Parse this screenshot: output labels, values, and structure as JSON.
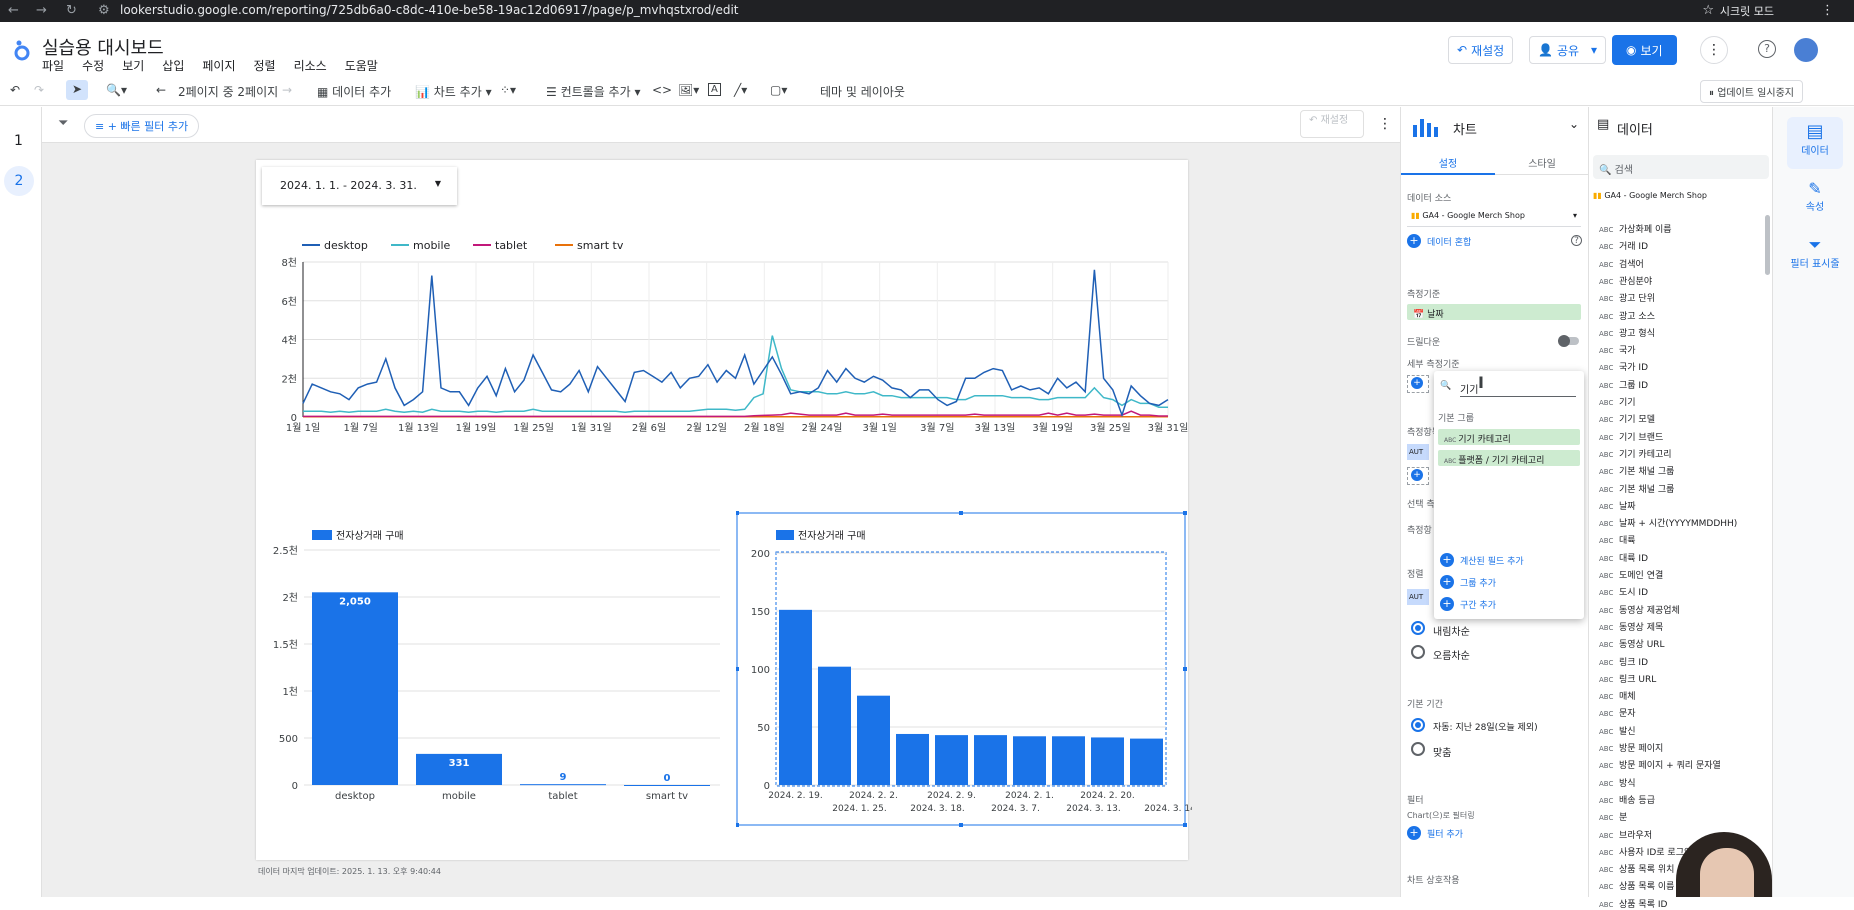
{
  "browser": {
    "url": "lookerstudio.google.com/reporting/725db6a0-c8dc-410e-be58-19ac12d06917/page/p_mvhqstxrod/edit",
    "incognito": "시크릿 모드"
  },
  "app": {
    "title": "실습용 대시보드",
    "menu": [
      "파일",
      "수정",
      "보기",
      "삽입",
      "페이지",
      "정렬",
      "리소스",
      "도움말"
    ],
    "reset_label": "재설정",
    "share_label": "공유",
    "view_label": "보기"
  },
  "toolbar": {
    "page_nav": "2페이지 중 2페이지",
    "add_data": "데이터 추가",
    "add_chart": "차트 추가",
    "add_control": "컨트롤을 추가",
    "theme": "테마 및 레이아웃",
    "pause_updates": "업데이트 일시중지"
  },
  "pages": [
    "1",
    "2"
  ],
  "filterbar": {
    "quick_filter": "+ 빠른 필터 추가",
    "reset": "재설정"
  },
  "date_range": "2024. 1. 1. - 2024. 3. 31.",
  "footer_note": "데이터 마지막 업데이트: 2025. 1. 13. 오후 9:40:44",
  "chart_data": [
    {
      "type": "line",
      "series": [
        {
          "name": "desktop",
          "color": "#1f5fb5",
          "values": [
            700,
            1700,
            1500,
            1300,
            1200,
            900,
            1500,
            1700,
            1800,
            3000,
            1500,
            600,
            900,
            1300,
            7300,
            1500,
            1300,
            1300,
            600,
            1500,
            2100,
            1100,
            2500,
            1300,
            1900,
            3200,
            2300,
            1400,
            1300,
            1700,
            2400,
            1300,
            2600,
            2000,
            1400,
            800,
            2300,
            2400,
            2100,
            1800,
            2300,
            1500,
            2000,
            2100,
            2700,
            1800,
            2400,
            2000,
            3200,
            1700,
            2400,
            3100,
            2200,
            1200,
            1300,
            1200,
            1500,
            2400,
            1800,
            2500,
            2000,
            1800,
            2100,
            1900,
            1500,
            1400,
            1000,
            1400,
            1400,
            900,
            600,
            800,
            2000,
            2000,
            2300,
            2500,
            2400,
            1400,
            1600,
            1400,
            1500,
            1200,
            2000,
            1500,
            1800,
            1300,
            7600,
            2000,
            1400,
            100,
            1600,
            1100,
            700,
            600,
            900
          ]
        },
        {
          "name": "mobile",
          "color": "#3fb8c8",
          "values": [
            300,
            300,
            300,
            250,
            300,
            250,
            300,
            300,
            300,
            400,
            300,
            250,
            300,
            250,
            400,
            300,
            300,
            300,
            250,
            300,
            300,
            250,
            300,
            300,
            300,
            400,
            300,
            300,
            300,
            300,
            300,
            300,
            300,
            300,
            300,
            250,
            300,
            300,
            300,
            300,
            300,
            300,
            300,
            350,
            400,
            400,
            400,
            350,
            400,
            1000,
            1200,
            4200,
            2500,
            1400,
            1300,
            1300,
            1300,
            1200,
            1200,
            1300,
            1200,
            1200,
            1300,
            1100,
            1100,
            1000,
            1000,
            1000,
            1000,
            1000,
            1000,
            900,
            900,
            1100,
            1100,
            1100,
            1100,
            1000,
            1000,
            1000,
            900,
            900,
            1000,
            1000,
            1000,
            1000,
            1500,
            1000,
            900,
            600,
            900,
            700,
            700,
            500,
            500
          ]
        },
        {
          "name": "tablet",
          "color": "#c2187a",
          "values": [
            30,
            30,
            30,
            30,
            30,
            30,
            30,
            30,
            30,
            30,
            30,
            30,
            30,
            30,
            30,
            30,
            30,
            30,
            30,
            30,
            30,
            30,
            30,
            30,
            30,
            30,
            30,
            30,
            30,
            30,
            30,
            30,
            30,
            30,
            30,
            30,
            30,
            30,
            30,
            30,
            30,
            30,
            30,
            30,
            30,
            30,
            30,
            30,
            30,
            60,
            80,
            100,
            120,
            200,
            150,
            100,
            100,
            100,
            100,
            200,
            100,
            100,
            100,
            150,
            100,
            100,
            100,
            100,
            100,
            100,
            100,
            100,
            100,
            150,
            100,
            100,
            100,
            100,
            100,
            100,
            100,
            200,
            100,
            200,
            100,
            100,
            150,
            100,
            100,
            100,
            300,
            100,
            100,
            50,
            50
          ]
        },
        {
          "name": "smart tv",
          "color": "#e8710a",
          "values": [
            10,
            10,
            10,
            10,
            10,
            10,
            10,
            10,
            10,
            10,
            10,
            10,
            10,
            10,
            10,
            10,
            10,
            10,
            10,
            10,
            10,
            10,
            10,
            10,
            10,
            10,
            10,
            10,
            10,
            10,
            10,
            10,
            10,
            10,
            10,
            10,
            10,
            10,
            10,
            10,
            10,
            10,
            10,
            10,
            10,
            10,
            10,
            10,
            10,
            10,
            10,
            10,
            10,
            10,
            10,
            10,
            10,
            10,
            10,
            10,
            10,
            10,
            10,
            10,
            10,
            10,
            10,
            10,
            10,
            10,
            10,
            10,
            10,
            10,
            10,
            10,
            10,
            10,
            10,
            10,
            10,
            10,
            10,
            10,
            10,
            10,
            10,
            10,
            10,
            10,
            10,
            10,
            10,
            10,
            10
          ]
        }
      ],
      "x_ticks": [
        "1월 1일",
        "1월 7일",
        "1월 13일",
        "1월 19일",
        "1월 25일",
        "1월 31일",
        "2월 6일",
        "2월 12일",
        "2월 18일",
        "2월 24일",
        "3월 1일",
        "3월 7일",
        "3월 13일",
        "3월 19일",
        "3월 25일",
        "3월 31일"
      ],
      "y_ticks": [
        "0",
        "2천",
        "4천",
        "6천",
        "8천"
      ],
      "ylim": [
        0,
        8000
      ],
      "legend": "top-left",
      "grid": true
    },
    {
      "type": "bar",
      "series": [
        {
          "name": "전자상거래 구매",
          "color": "#1a73e8"
        }
      ],
      "categories": [
        "desktop",
        "mobile",
        "tablet",
        "smart tv"
      ],
      "values": [
        2050,
        331,
        9,
        0
      ],
      "labels": [
        "2,050",
        "331",
        "9",
        "0"
      ],
      "y_ticks": [
        "0",
        "500",
        "1천",
        "1.5천",
        "2천",
        "2.5천"
      ],
      "ylim": [
        0,
        2500
      ]
    },
    {
      "type": "bar",
      "series": [
        {
          "name": "전자상거래 구매",
          "color": "#1a73e8"
        }
      ],
      "categories": [
        "2024. 2. 19.",
        "2024. 1. 25.",
        "2024. 2. 2.",
        "2024. 3. 18.",
        "2024. 2. 9.",
        "2024. 3. 7.",
        "2024. 2. 1.",
        "2024. 3. 13.",
        "2024. 2. 20.",
        "2024. 3. 14."
      ],
      "values": [
        151,
        102,
        77,
        44,
        43,
        43,
        42,
        42,
        41,
        40
      ],
      "y_ticks": [
        "0",
        "50",
        "100",
        "150",
        "200"
      ],
      "ylim": [
        0,
        200
      ]
    }
  ],
  "panel_chart": {
    "title": "차트",
    "tabs": [
      "설정",
      "스타일"
    ],
    "data_source_label": "데이터 소스",
    "data_source": "GA4 - Google Merch Shop",
    "blend": "데이터 혼합",
    "dimension_label": "측정기준",
    "dimension": "날짜",
    "drilldown": "드릴다운",
    "breakdown_label": "세부 측정기준",
    "metric_label": "측정항목",
    "optional_label": "선택 측",
    "metric_sort_label": "측정항",
    "sort_label": "정렬",
    "aut": "AUT",
    "desc": "내림차순",
    "asc": "오름차순",
    "default_range_label": "기본 기간",
    "auto_range": "자동: 지난 28일(오늘 제외)",
    "custom_range": "맞춤",
    "filter_label": "필터",
    "filter_sub": "Chart(으)로 필터링",
    "add_filter": "필터 추가",
    "interaction": "차트 상호작용"
  },
  "popup": {
    "search": "기기",
    "group": "기본 그룹",
    "options": [
      "기기 카테고리",
      "플랫폼 / 기기 카테고리"
    ],
    "links": [
      "계산된 필드 추가",
      "그룹 추가",
      "구간 추가"
    ]
  },
  "panel_data": {
    "title": "데이터",
    "search_placeholder": "검색",
    "source": "GA4 - Google Merch Shop",
    "fields": [
      "가상화폐 이름",
      "거래 ID",
      "검색어",
      "관심분야",
      "광고 단위",
      "광고 소스",
      "광고 형식",
      "국가",
      "국가 ID",
      "그룹 ID",
      "기기",
      "기기 모델",
      "기기 브랜드",
      "기기 카테고리",
      "기본 채널 그룹",
      "기본 채널 그룹",
      "날짜",
      "날짜 + 시간(YYYYMMDDHH)",
      "대륙",
      "대륙 ID",
      "도메인 연결",
      "도시 ID",
      "동영상 제공업체",
      "동영상 제목",
      "동영상 URL",
      "링크 ID",
      "링크 URL",
      "매체",
      "문자",
      "발신",
      "방문 페이지",
      "방문 페이지 + 쿼리 문자열",
      "방식",
      "배송 등급",
      "분",
      "브라우저",
      "사용자 ID로 로그인함",
      "상품 목록 위치",
      "상품 목록 이름",
      "상품 목록 ID"
    ]
  },
  "rail": [
    "데이터",
    "속성",
    "필터 표시줄"
  ]
}
